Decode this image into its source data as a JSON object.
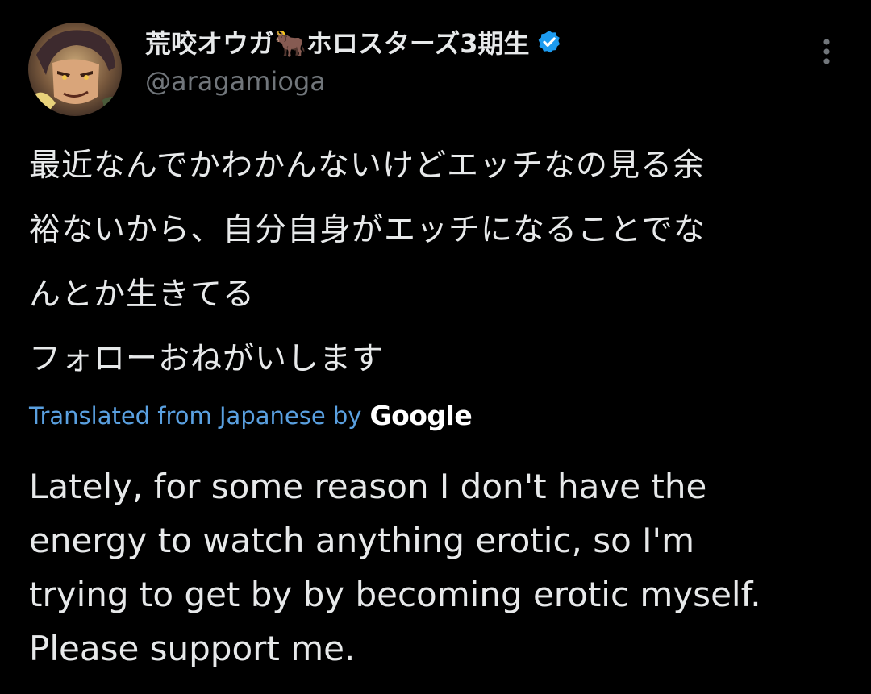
{
  "author": {
    "display_name": "荒咬オウガ🐂ホロスターズ3期生",
    "handle": "@aragamioga",
    "verified": true,
    "avatar_icon": "avatar-illustration"
  },
  "menu": {
    "icon": "more-vertical-icon"
  },
  "post": {
    "text_original": "最近なんでかわかんないけどエッチなの見る余\n裕ないから、自分自身がエッチになることでな\nんとか生きてる\nフォローおねがいします",
    "translation_label": "Translated from Japanese by",
    "translation_provider": "Google",
    "text_translated": "Lately, for some reason I don't have the\nenergy to watch anything erotic, so I'm\ntrying to get by by becoming erotic myself.\nPlease support me."
  },
  "colors": {
    "background": "#000000",
    "text_primary": "#e7e9ea",
    "text_secondary": "#71767b",
    "link": "#5aa0e0",
    "verified": "#1d9bf0"
  }
}
